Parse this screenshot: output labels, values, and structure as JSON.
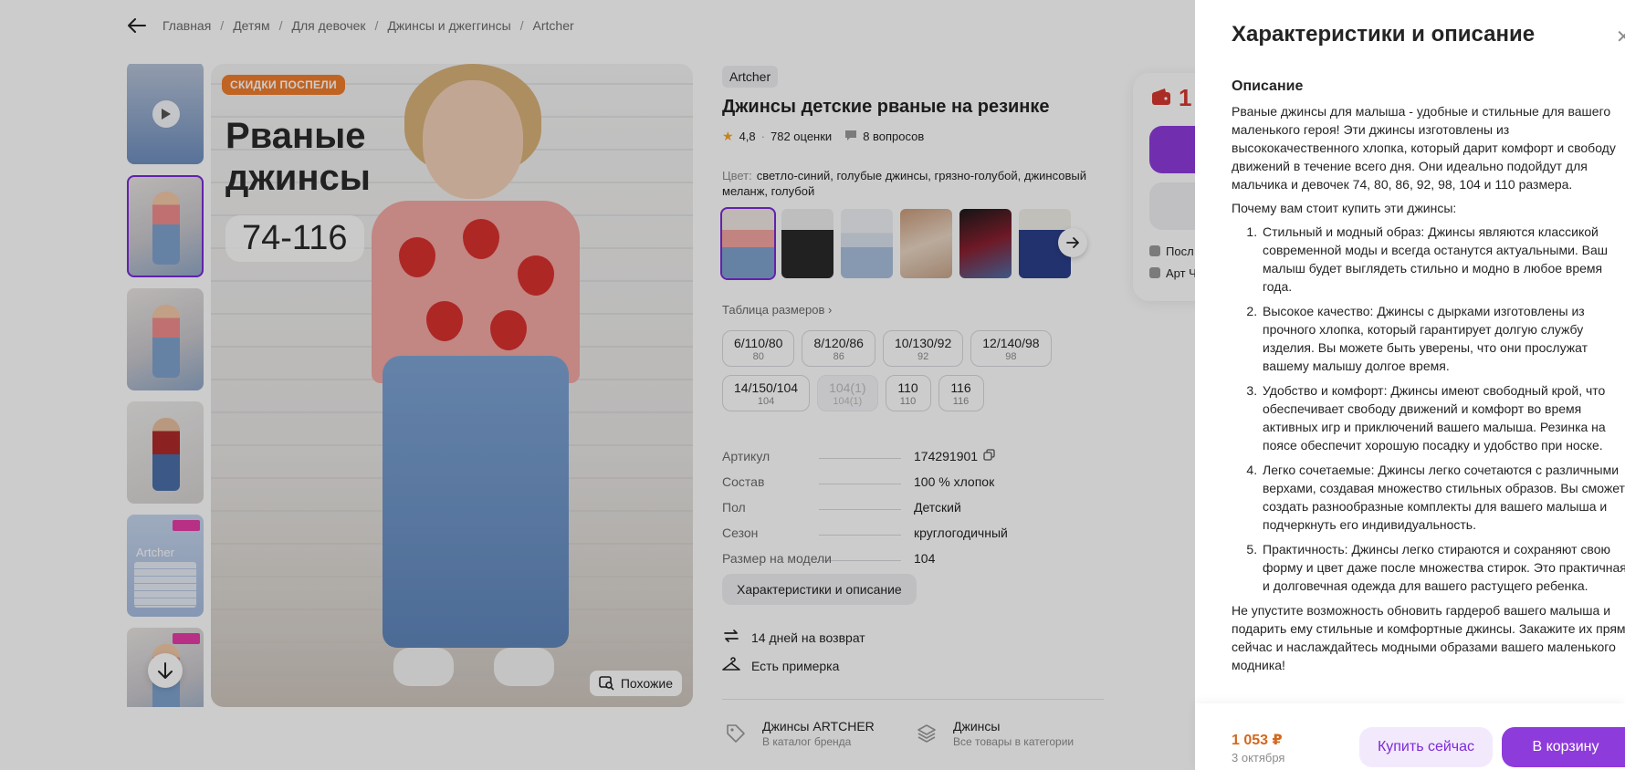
{
  "breadcrumb": {
    "items": [
      "Главная",
      "Детям",
      "Для девочек",
      "Джинсы и джеггинсы",
      "Artcher"
    ],
    "separator": "/"
  },
  "gallery": {
    "promo_badge": "СКИДКИ ПОСПЕЛИ",
    "photo_title_line1": "Рваные",
    "photo_title_line2": "джинсы",
    "photo_sizes": "74-116",
    "similar_label": "Похожие",
    "thumb_chart_label": "Artcher"
  },
  "product": {
    "brand": "Artcher",
    "title": "Джинсы детские рваные на резинке",
    "rating": "4,8",
    "reviews": "782 оценки",
    "questions": "8 вопросов",
    "color_label": "Цвет:",
    "color_value": "светло-синий, голубые джинсы, грязно-голубой, джинсовый меланж, голубой",
    "size_table_label": "Таблица размеров",
    "sizes": [
      {
        "main": "6/110/80",
        "sub": "80",
        "disabled": false
      },
      {
        "main": "8/120/86",
        "sub": "86",
        "disabled": false
      },
      {
        "main": "10/130/92",
        "sub": "92",
        "disabled": false
      },
      {
        "main": "12/140/98",
        "sub": "98",
        "disabled": false
      },
      {
        "main": "14/150/104",
        "sub": "104",
        "disabled": false
      },
      {
        "main": "104(1)",
        "sub": "104(1)",
        "disabled": true
      },
      {
        "main": "110",
        "sub": "110",
        "disabled": false
      },
      {
        "main": "116",
        "sub": "116",
        "disabled": false
      }
    ],
    "specs": [
      {
        "key": "Артикул",
        "value": "174291901"
      },
      {
        "key": "Состав",
        "value": "100 % хлопок"
      },
      {
        "key": "Пол",
        "value": "Детский"
      },
      {
        "key": "Сезон",
        "value": "круглогодичный"
      },
      {
        "key": "Размер на модели",
        "value": "104"
      }
    ],
    "characteristics_button": "Характеристики и описание",
    "perk_return": "14 дней на возврат",
    "perk_fitting": "Есть примерка",
    "brand_link_title": "Джинсы ARTCHER",
    "brand_link_sub": "В каталог бренда",
    "category_link_title": "Джинсы",
    "category_link_sub": "Все товары в категории"
  },
  "price_card": {
    "price_partial": "1",
    "line1": "Посл",
    "line2": "Арт Ч"
  },
  "drawer": {
    "title": "Характеристики и описание",
    "section_title": "Описание",
    "intro": "Рваные джинсы для малыша - удобные и стильные для вашего маленького героя! Эти джинсы изготовлены из высококачественного хлопка, который дарит комфорт и свободу движений в течение всего дня. Они идеально подойдут для мальчика и девочек 74, 80, 86, 92, 98, 104 и 110 размера.",
    "why": "Почему вам стоит купить эти джинсы:",
    "points": [
      "Стильный и модный образ: Джинсы являются классикой современной моды и всегда останутся актуальными. Ваш малыш будет выглядеть стильно и модно в любое время года.",
      "Высокое качество: Джинсы с дырками изготовлены из прочного хлопка, который гарантирует долгую службу изделия. Вы можете быть уверены, что они прослужат вашему малышу долгое время.",
      "Удобство и комфорт: Джинсы имеют свободный крой, что обеспечивает свободу движений и комфорт во время активных игр и приключений вашего малыша. Резинка на поясе обеспечит хорошую посадку и удобство при носке.",
      "Легко сочетаемые: Джинсы легко сочетаются с различными верхами, создавая множество стильных образов. Вы сможете создать разнообразные комплекты для вашего малыша и подчеркнуть его индивидуальность.",
      "Практичность: Джинсы легко стираются и сохраняют свою форму и цвет даже после множества стирок. Это практичная и долговечная одежда для вашего растущего ребенка."
    ],
    "outro": "Не упустите возможность обновить гардероб вашего малыша и подарить ему стильные и комфортные джинсы. Закажите их прямо сейчас и наслаждайтесь модными образами вашего маленького модника!",
    "footer_price": "1 053 ₽",
    "footer_date": "3 октября",
    "buy_now": "Купить сейчас",
    "to_cart": "В корзину"
  },
  "colors": {
    "accent": "#8e3bdc",
    "accent_light": "#f3e9fd",
    "price": "#d2691e",
    "promo": "#f07d2e",
    "star": "#f5a623"
  }
}
